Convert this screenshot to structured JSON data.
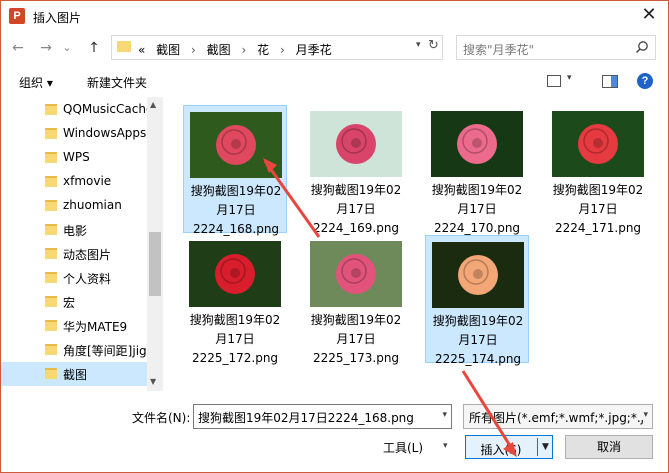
{
  "window": {
    "title": "插入图片",
    "app_icon": "powerpoint-icon",
    "app_icon_letter": "P",
    "close_glyph": "✕"
  },
  "nav": {
    "back_glyph": "←",
    "forward_glyph": "→",
    "recent_glyph": "⌄",
    "up_glyph": "↑",
    "overflow": "«",
    "breadcrumb": [
      "截图",
      "截图",
      "花",
      "月季花"
    ],
    "separator": "›",
    "refresh_glyph": "↻"
  },
  "search": {
    "placeholder": "搜索\"月季花\""
  },
  "toolbar": {
    "organize": "组织 ▾",
    "new_folder": "新建文件夹",
    "help": "?"
  },
  "sidebar": {
    "items": [
      {
        "label": "QQMusicCache",
        "selected": false
      },
      {
        "label": "WindowsApps",
        "selected": false
      },
      {
        "label": "WPS",
        "selected": false
      },
      {
        "label": "xfmovie",
        "selected": false
      },
      {
        "label": "zhuomian",
        "selected": false
      },
      {
        "label": "电影",
        "selected": false
      },
      {
        "label": "动态图片",
        "selected": false
      },
      {
        "label": "个人资料",
        "selected": false
      },
      {
        "label": "宏",
        "selected": false
      },
      {
        "label": "华为MATE9",
        "selected": false
      },
      {
        "label": "角度[等间距]jig",
        "selected": false
      },
      {
        "label": "截图",
        "selected": true
      }
    ]
  },
  "files": [
    {
      "line1": "搜狗截图19年02",
      "line2": "月17日",
      "line3": "2224_168.png",
      "selected": true,
      "colors": [
        "#2f5a1e",
        "#e0485f"
      ]
    },
    {
      "line1": "搜狗截图19年02",
      "line2": "月17日",
      "line3": "2224_169.png",
      "selected": false,
      "colors": [
        "#cfe4d8",
        "#d9456a"
      ]
    },
    {
      "line1": "搜狗截图19年02",
      "line2": "月17日",
      "line3": "2224_170.png",
      "selected": false,
      "colors": [
        "#163814",
        "#ec6a8c"
      ]
    },
    {
      "line1": "搜狗截图19年02",
      "line2": "月17日",
      "line3": "2224_171.png",
      "selected": false,
      "colors": [
        "#1d4a1a",
        "#e53a3f"
      ]
    },
    {
      "line1": "搜狗截图19年02",
      "line2": "月17日",
      "line3": "2225_172.png",
      "selected": false,
      "colors": [
        "#1f3e17",
        "#d81e2c"
      ]
    },
    {
      "line1": "搜狗截图19年02",
      "line2": "月17日",
      "line3": "2225_173.png",
      "selected": false,
      "colors": [
        "#6f8a5a",
        "#e2537c"
      ]
    },
    {
      "line1": "搜狗截图19年02",
      "line2": "月17日",
      "line3": "2225_174.png",
      "selected": true,
      "colors": [
        "#1a2b10",
        "#f3a676"
      ]
    }
  ],
  "bottom": {
    "filename_label": "文件名(N):",
    "filename_value": "搜狗截图19年02月17日2224_168.png",
    "filetype_value": "所有图片(*.emf;*.wmf;*.jpg;*.j",
    "tools": "工具(L)",
    "insert": "插入(S)",
    "cancel": "取消"
  },
  "colors": {
    "accent": "#0078d7",
    "selection": "#cce8ff",
    "annotation_arrow": "#e8473e"
  }
}
